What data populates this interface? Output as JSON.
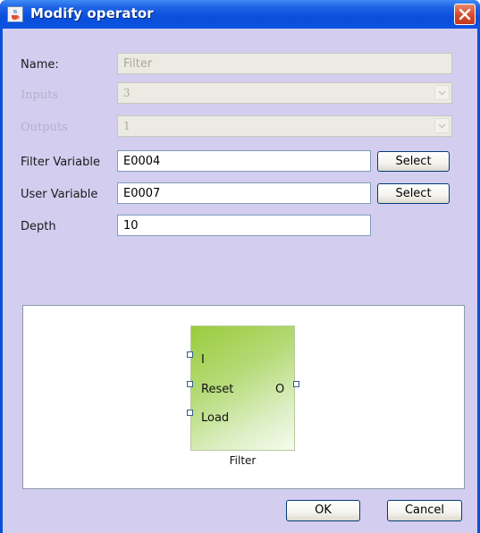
{
  "window": {
    "title": "Modify operator",
    "title_bar_color": "#0b4fd8",
    "client_background": "#d3cdf0"
  },
  "form": {
    "name": {
      "label": "Name:",
      "value": "Filter",
      "enabled": false
    },
    "inputs": {
      "label": "Inputs",
      "value": "3",
      "enabled": false
    },
    "outputs": {
      "label": "Outputs",
      "value": "1",
      "enabled": false
    },
    "filter_variable": {
      "label": "Filter Variable",
      "value": "E0004",
      "button": "Select"
    },
    "user_variable": {
      "label": "User Variable",
      "value": "E0007",
      "button": "Select"
    },
    "depth": {
      "label": "Depth",
      "value": "10"
    }
  },
  "preview": {
    "block_name": "Filter",
    "block_color": "#9acc3c",
    "input_ports": [
      "I",
      "Reset",
      "Load"
    ],
    "output_ports": [
      "O"
    ]
  },
  "footer": {
    "ok_label": "OK",
    "cancel_label": "Cancel"
  }
}
